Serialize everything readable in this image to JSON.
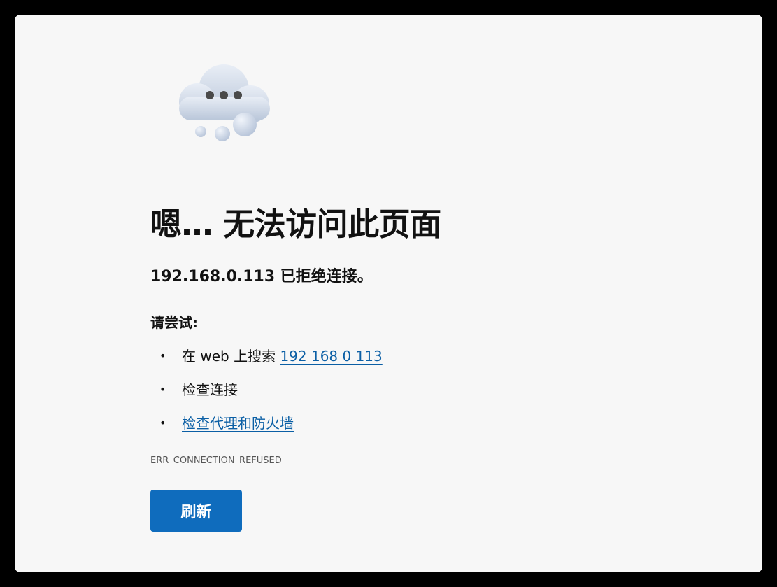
{
  "page": {
    "title": "嗯… 无法访问此页面",
    "subtitle": "192.168.0.113 已拒绝连接。",
    "try_heading": "请尝试:",
    "suggestions": [
      {
        "prefix": "在 web 上搜索 ",
        "link": "192 168 0 113"
      },
      {
        "text": "检查连接"
      },
      {
        "link": "检查代理和防火墙"
      }
    ],
    "bullet": "•",
    "error_code": "ERR_CONNECTION_REFUSED",
    "refresh_label": "刷新"
  },
  "icons": {
    "illustration": "cloud-icon"
  },
  "colors": {
    "background": "#f7f7f7",
    "link": "#0b5fa5",
    "button": "#0f6cbd",
    "button_text": "#ffffff",
    "text": "#111111"
  }
}
